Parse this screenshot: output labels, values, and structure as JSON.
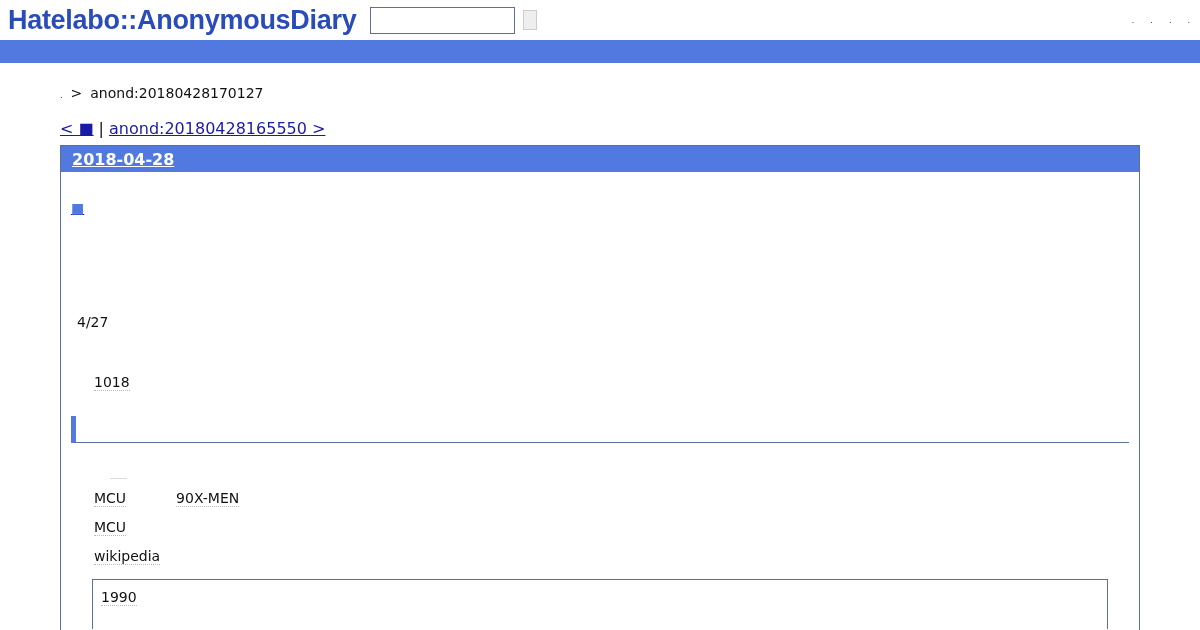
{
  "header": {
    "logo": "Hatelabo::AnonymousDiary",
    "menu": [
      ".",
      ".",
      ".",
      "."
    ]
  },
  "breadcrumb": {
    "mark": ".",
    "separator": ">",
    "current": "anond:20180428170127"
  },
  "pager": {
    "prev": "< ■",
    "separator": "|",
    "next": "anond:20180428165550 >"
  },
  "entry": {
    "date": "2018-04-28",
    "title": "■",
    "date_line": "4/27",
    "count": "1018",
    "links": [
      {
        "items": [
          "MCU",
          "90X-MEN"
        ]
      },
      {
        "items": [
          "MCU"
        ]
      },
      {
        "items": [
          "wikipedia"
        ]
      }
    ],
    "quote": "1990"
  }
}
